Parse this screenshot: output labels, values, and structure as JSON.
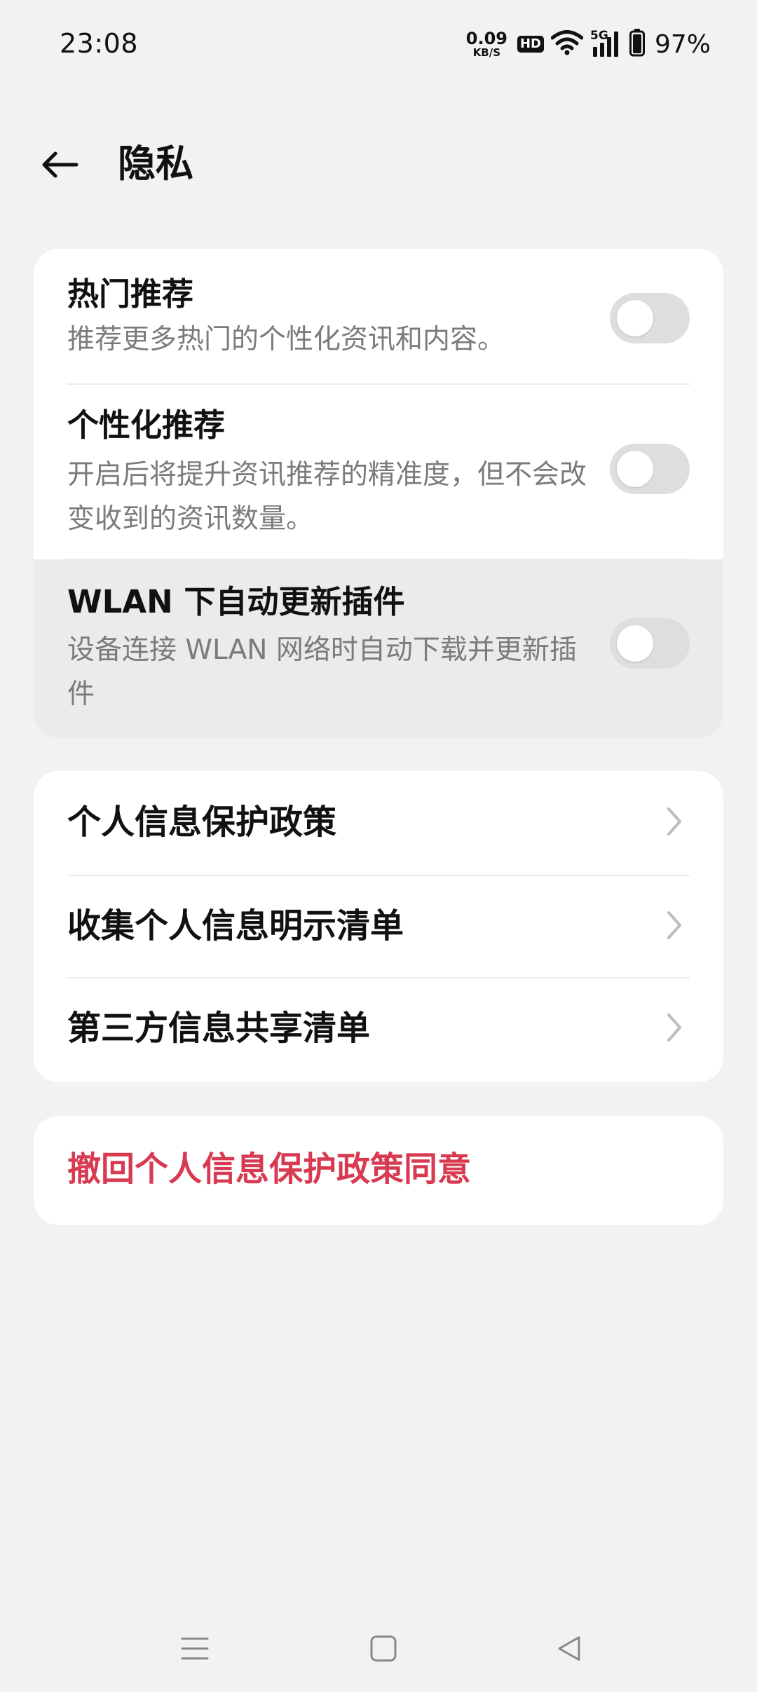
{
  "status_bar": {
    "time": "23:08",
    "net_speed_value": "0.09",
    "net_speed_unit": "KB/S",
    "hd_badge": "HD",
    "signal_label": "5G",
    "battery_percent": "97%",
    "icons": [
      "wifi-icon",
      "cellular-signal-icon",
      "battery-icon"
    ]
  },
  "header": {
    "back_icon": "arrow-left-icon",
    "title": "隐私"
  },
  "toggle_settings": [
    {
      "title": "热门推荐",
      "description": "推荐更多热门的个性化资讯和内容。",
      "enabled": false
    },
    {
      "title": "个性化推荐",
      "description": "开启后将提升资讯推荐的精准度，但不会改变收到的资讯数量。",
      "enabled": false
    },
    {
      "title": "WLAN 下自动更新插件",
      "description": "设备连接 WLAN 网络时自动下载并更新插件",
      "enabled": false
    }
  ],
  "links": [
    {
      "label": "个人信息保护政策",
      "icon": "chevron-right-icon"
    },
    {
      "label": "收集个人信息明示清单",
      "icon": "chevron-right-icon"
    },
    {
      "label": "第三方信息共享清单",
      "icon": "chevron-right-icon"
    }
  ],
  "revoke": {
    "label": "撤回个人信息保护政策同意",
    "color": "#d83a52"
  },
  "nav_bar": {
    "icons": [
      "menu-icon",
      "home-square-icon",
      "back-triangle-icon"
    ]
  },
  "colors": {
    "background": "#f1f2f4",
    "card": "#ffffff",
    "switch_off": "#dedede",
    "pressed_row": "#ebebeb",
    "secondary_text": "#7b7b7b"
  }
}
